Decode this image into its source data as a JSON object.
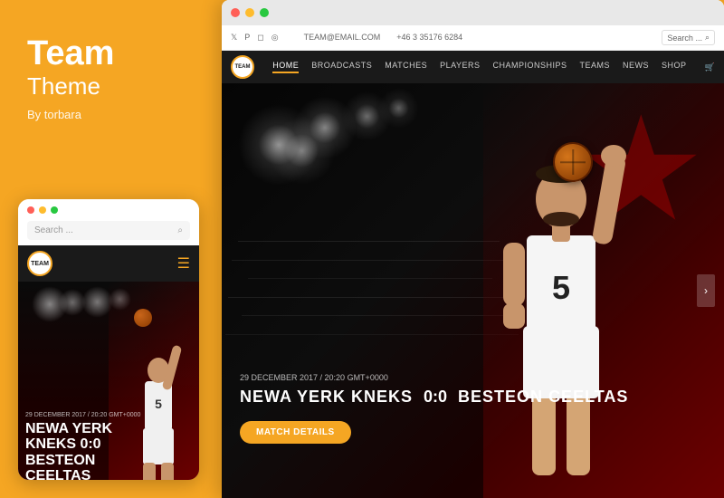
{
  "left": {
    "title": "Team",
    "subtitle": "Theme",
    "author": "By torbara"
  },
  "mobile": {
    "search_placeholder": "Search ...",
    "logo_text": "TEAM",
    "date": "29 DECEMBER 2017 / 20:20 GMT+0000",
    "match_line1": "NEWA YERK",
    "match_line2": "KNEKS   0:0",
    "match_line3": "BESTEON",
    "match_line4": "CEELTAS"
  },
  "desktop": {
    "top_bar": {
      "twitter": "𝕏",
      "pinterest": "P",
      "instagram": "◻",
      "rss": "◎",
      "email_label": "TEAM@EMAIL.COM",
      "phone_label": "+46 3 35176 6284",
      "search_placeholder": "Search ..."
    },
    "nav": {
      "logo_text": "TEAM",
      "items": [
        {
          "label": "HOME",
          "active": true
        },
        {
          "label": "BROADCASTS",
          "active": false
        },
        {
          "label": "MATCHES",
          "active": false
        },
        {
          "label": "PLAYERS",
          "active": false
        },
        {
          "label": "CHAMPIONSHIPS",
          "active": false
        },
        {
          "label": "TEAMS",
          "active": false
        },
        {
          "label": "NEWS",
          "active": false
        },
        {
          "label": "SHOP",
          "active": false
        }
      ]
    },
    "hero": {
      "date": "29 DECEMBER 2017 / 20:20 GMT+0000",
      "team1": "NEWA YERK KNEKS",
      "score": "0:0",
      "team2": "BESTEON CEELTAS",
      "cta_label": "MATCH DETAILS",
      "player_number": "5"
    }
  },
  "dots": {
    "red": "#FF5F57",
    "yellow": "#FEBC2E",
    "green": "#28C840"
  }
}
